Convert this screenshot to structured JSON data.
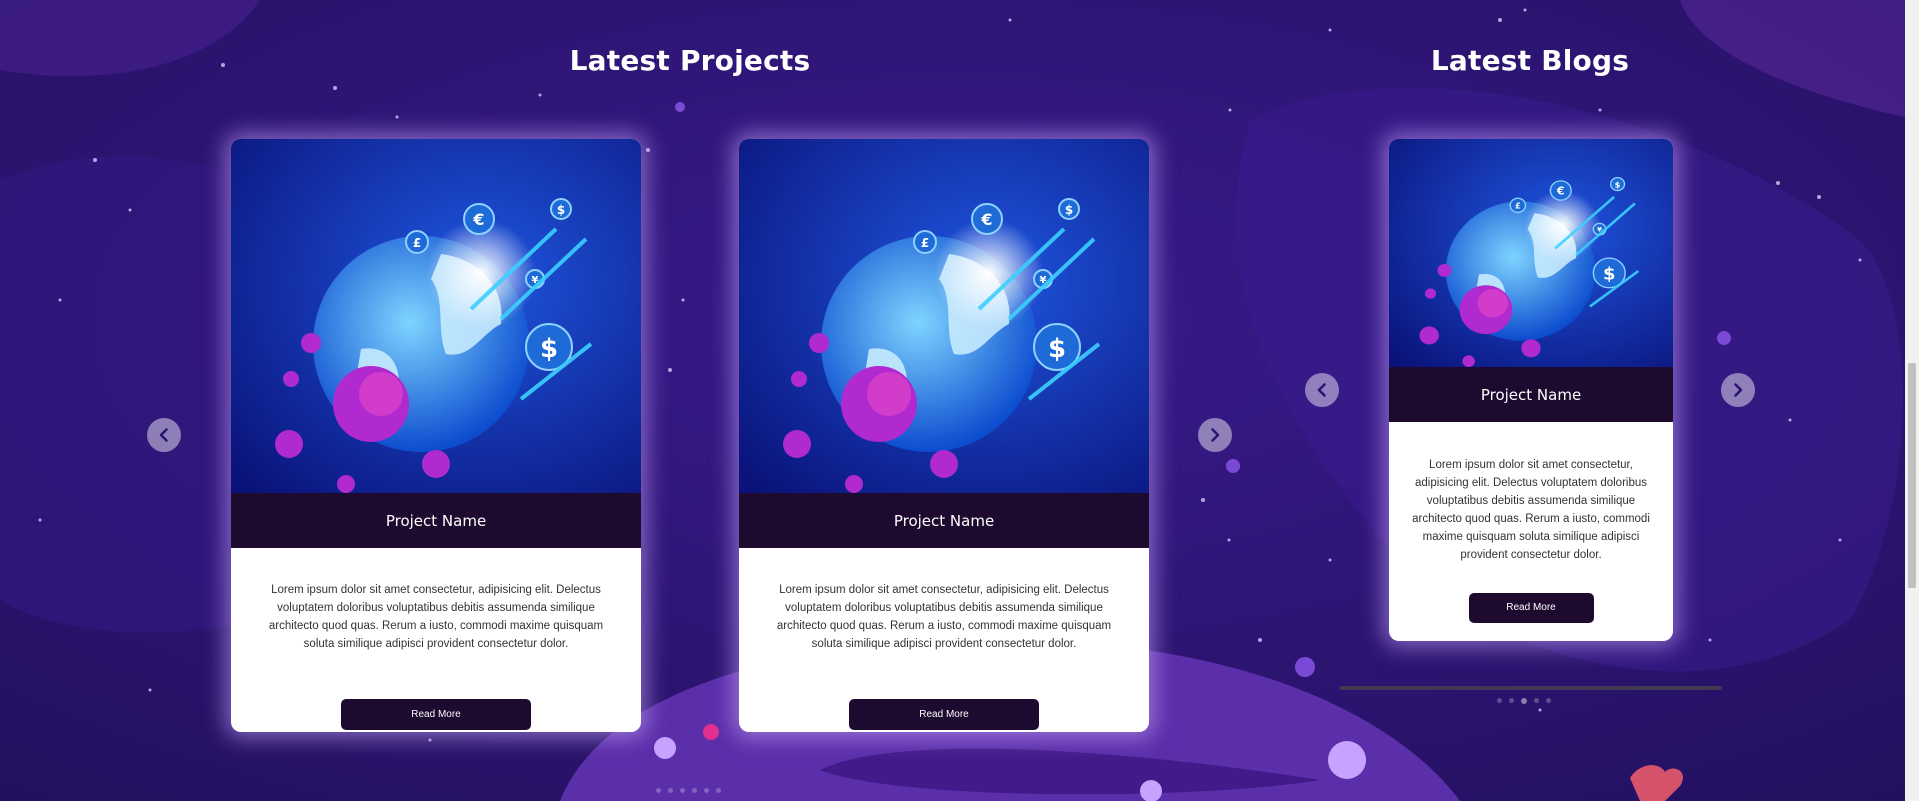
{
  "colors": {
    "background": "#2c1474",
    "card_header": "#1e0a2e",
    "button": "#1e0a2e",
    "glow": "#cdaaff"
  },
  "projects": {
    "title": "Latest Projects",
    "cards": [
      {
        "name": "Project Name",
        "description": "Lorem ipsum dolor sit amet consectetur, adipisicing elit. Delectus voluptatem doloribus voluptatibus debitis assumenda similique architecto quod quas. Rerum a iusto, commodi maxime quisquam soluta similique adipisci provident consectetur dolor.",
        "button_label": "Read More",
        "image_icon": "globe-currency-virus-image"
      },
      {
        "name": "Project Name",
        "description": "Lorem ipsum dolor sit amet consectetur, adipisicing elit. Delectus voluptatem doloribus voluptatibus debitis assumenda similique architecto quod quas. Rerum a iusto, commodi maxime quisquam soluta similique adipisci provident consectetur dolor.",
        "button_label": "Read More",
        "image_icon": "globe-currency-virus-image"
      }
    ],
    "prev_icon": "chevron-left-icon",
    "next_icon": "chevron-right-icon"
  },
  "blogs": {
    "title": "Latest Blogs",
    "cards": [
      {
        "name": "Project Name",
        "description": "Lorem ipsum dolor sit amet consectetur, adipisicing elit. Delectus voluptatem doloribus voluptatibus debitis assumenda similique architecto quod quas. Rerum a iusto, commodi maxime quisquam soluta similique adipisci provident consectetur dolor.",
        "button_label": "Read More",
        "image_icon": "globe-currency-virus-image"
      }
    ],
    "prev_icon": "chevron-left-icon",
    "next_icon": "chevron-right-icon"
  }
}
